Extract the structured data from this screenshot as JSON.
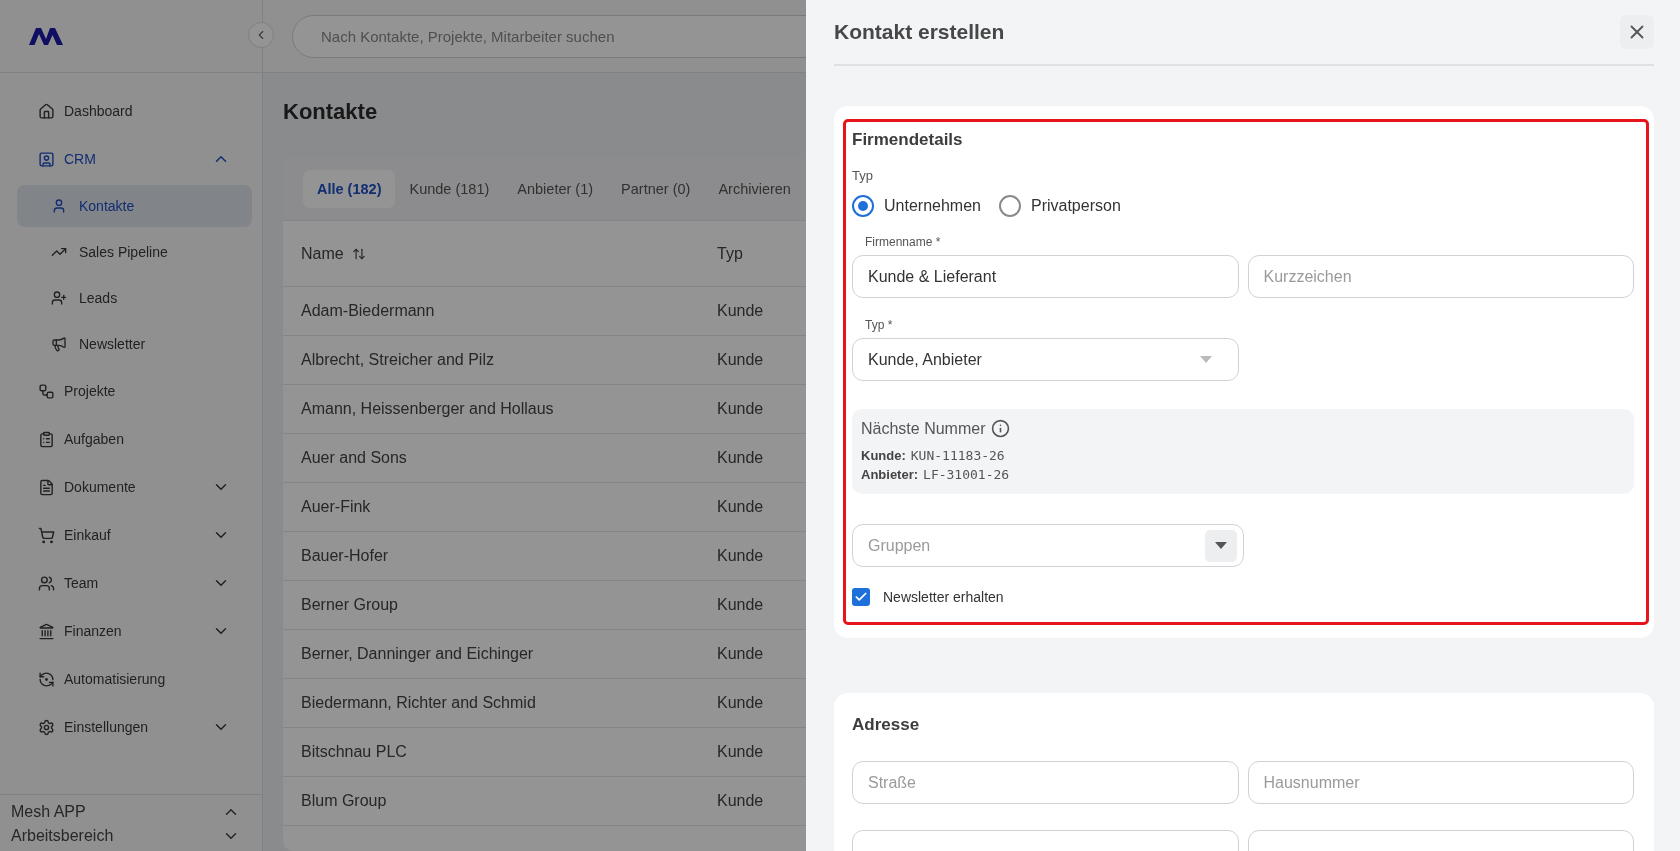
{
  "sidebar": {
    "items": [
      {
        "label": "Dashboard",
        "kind": "link",
        "selected": false
      },
      {
        "label": "CRM",
        "kind": "group",
        "selected": true,
        "expanded": true,
        "children": [
          {
            "label": "Kontakte",
            "selected": true
          },
          {
            "label": "Sales Pipeline",
            "selected": false
          },
          {
            "label": "Leads",
            "selected": false
          },
          {
            "label": "Newsletter",
            "selected": false
          }
        ]
      },
      {
        "label": "Projekte",
        "kind": "link",
        "selected": false
      },
      {
        "label": "Aufgaben",
        "kind": "link",
        "selected": false
      },
      {
        "label": "Dokumente",
        "kind": "group",
        "selected": false,
        "expanded": false
      },
      {
        "label": "Einkauf",
        "kind": "group",
        "selected": false,
        "expanded": false
      },
      {
        "label": "Team",
        "kind": "group",
        "selected": false,
        "expanded": false
      },
      {
        "label": "Finanzen",
        "kind": "group",
        "selected": false,
        "expanded": false
      },
      {
        "label": "Automatisierung",
        "kind": "link",
        "selected": false
      },
      {
        "label": "Einstellungen",
        "kind": "group",
        "selected": false,
        "expanded": false
      }
    ],
    "footer": {
      "app": "Mesh APP",
      "workspace": "Arbeitsbereich"
    }
  },
  "search": {
    "placeholder": "Nach Kontakte, Projekte, Mitarbeiter suchen"
  },
  "page_title": "Kontakte",
  "tabs": [
    {
      "label": "Alle (182)",
      "selected": true
    },
    {
      "label": "Kunde (181)",
      "selected": false
    },
    {
      "label": "Anbieter (1)",
      "selected": false
    },
    {
      "label": "Partner (0)",
      "selected": false
    },
    {
      "label": "Archivieren",
      "selected": false
    }
  ],
  "table": {
    "columns": [
      "Name",
      "Typ"
    ],
    "rows": [
      [
        "Adam-Biedermann",
        "Kunde"
      ],
      [
        "Albrecht, Streicher and Pilz",
        "Kunde"
      ],
      [
        "Amann, Heissenberger and Hollaus",
        "Kunde"
      ],
      [
        "Auer and Sons",
        "Kunde"
      ],
      [
        "Auer-Fink",
        "Kunde"
      ],
      [
        "Bauer-Hofer",
        "Kunde"
      ],
      [
        "Berner Group",
        "Kunde"
      ],
      [
        "Berner, Danninger and Eichinger",
        "Kunde"
      ],
      [
        "Biedermann, Richter and Schmid",
        "Kunde"
      ],
      [
        "Bitschnau PLC",
        "Kunde"
      ],
      [
        "Blum Group",
        "Kunde"
      ]
    ]
  },
  "panel": {
    "title": "Kontakt erstellen",
    "company": {
      "title": "Firmendetails",
      "type_label": "Typ",
      "radios": [
        {
          "label": "Unternehmen",
          "selected": true
        },
        {
          "label": "Privatperson",
          "selected": false
        }
      ],
      "name_field": {
        "label": "Firmenname *",
        "value": "Kunde & Lieferant"
      },
      "short_field": {
        "placeholder": "Kurzzeichen"
      },
      "type_select": {
        "label": "Typ *",
        "value": "Kunde, Anbieter"
      },
      "next_number": {
        "title": "Nächste Nummer",
        "entries": [
          {
            "label": "Kunde:",
            "value": "KUN-11183-26"
          },
          {
            "label": "Anbieter:",
            "value": "LF-31001-26"
          }
        ]
      },
      "groups_select": {
        "placeholder": "Gruppen"
      },
      "newsletter": {
        "label": "Newsletter erhalten",
        "checked": true
      }
    },
    "address": {
      "title": "Adresse",
      "fields": [
        {
          "placeholder": "Straße"
        },
        {
          "placeholder": "Hausnummer"
        }
      ]
    }
  }
}
